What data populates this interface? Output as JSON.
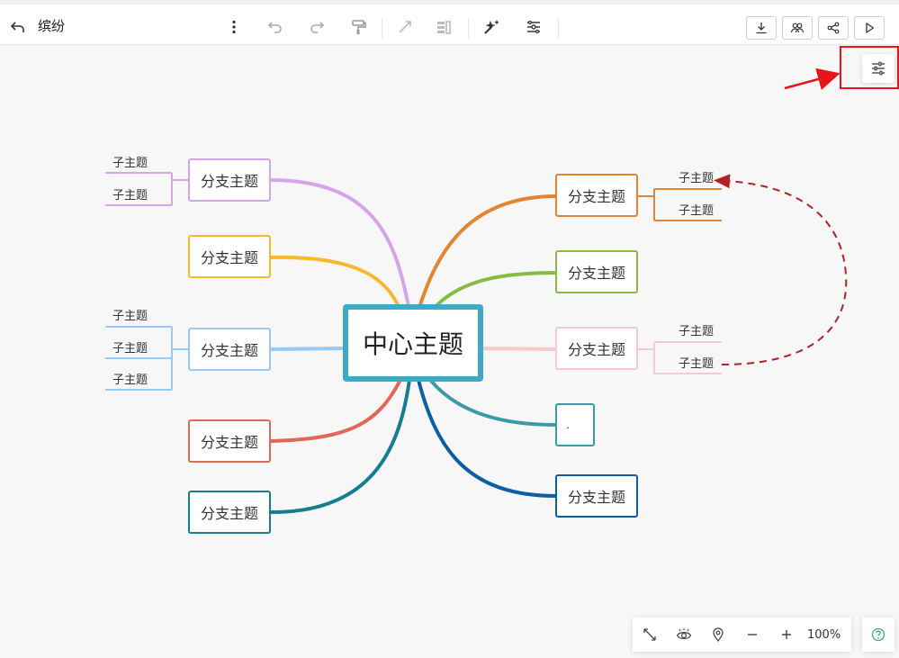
{
  "header": {
    "title": "缤纷"
  },
  "mindmap": {
    "center": {
      "label": "中心主题",
      "color": "#3fa9c9"
    },
    "branches": [
      {
        "label": "分支主题",
        "color": "#d4a5e9",
        "children": [
          "子主题",
          "子主题"
        ]
      },
      {
        "label": "分支主题",
        "color": "#f7b82b",
        "children": []
      },
      {
        "label": "分支主题",
        "color": "#99c9f5",
        "children": [
          "子主题",
          "子主题",
          "子主题"
        ]
      },
      {
        "label": "分支主题",
        "color": "#e06759",
        "children": []
      },
      {
        "label": "分支主题",
        "color": "#177e8f",
        "children": []
      },
      {
        "label": "分支主题",
        "color": "#e58431",
        "children": [
          "子主题",
          "子主题"
        ]
      },
      {
        "label": "分支主题",
        "color": "#86bc44",
        "children": []
      },
      {
        "label": "分支主题",
        "color": "#fbc9cb",
        "children": [
          "子主题",
          "子主题"
        ]
      },
      {
        "label": ".",
        "color": "#3a9aa6",
        "children": []
      },
      {
        "label": "分支主题",
        "color": "#0d5fa5",
        "children": []
      }
    ],
    "relation_color": "#b22222"
  },
  "zoom": {
    "level": "100%"
  },
  "colors": {
    "annotation": "#e8141b",
    "help": "#2bb673"
  }
}
